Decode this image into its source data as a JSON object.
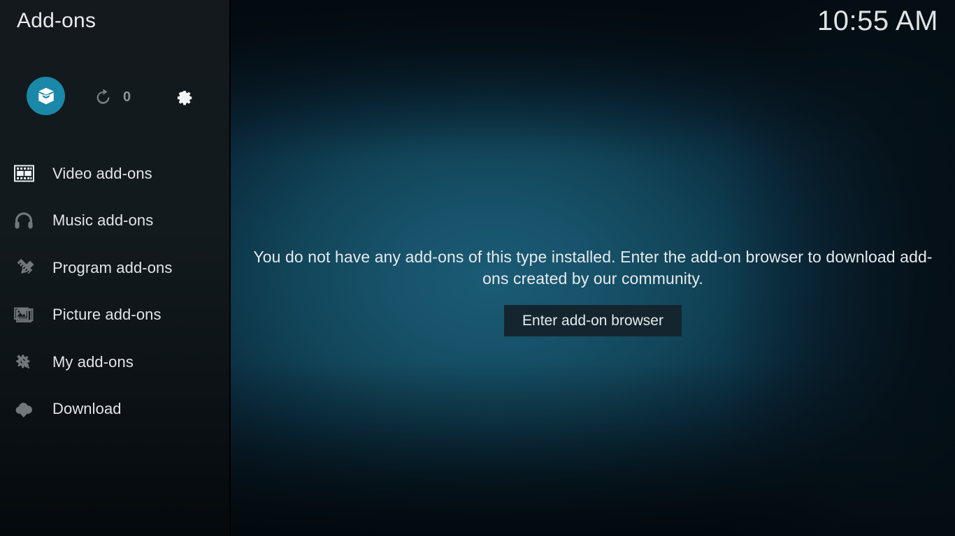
{
  "header": {
    "title": "Add-ons",
    "clock": "10:55 AM"
  },
  "icon_bar": {
    "addons_badge_icon": "open-box-icon",
    "addons_badge_color": "#1a88a8",
    "refresh_icon": "refresh-icon",
    "refresh_count": "0",
    "settings_icon": "gear-icon"
  },
  "sidebar": {
    "items": [
      {
        "label": "Video add-ons",
        "icon": "film-strip-icon",
        "selected": true
      },
      {
        "label": "Music add-ons",
        "icon": "headphones-icon",
        "selected": false
      },
      {
        "label": "Program add-ons",
        "icon": "pencil-ruler-icon",
        "selected": false
      },
      {
        "label": "Picture add-ons",
        "icon": "picture-stack-icon",
        "selected": false
      },
      {
        "label": "My add-ons",
        "icon": "gear-screwdriver-icon",
        "selected": false
      },
      {
        "label": "Download",
        "icon": "cloud-download-icon",
        "selected": false
      }
    ]
  },
  "main": {
    "empty_message": "You do not have any add-ons of this type installed. Enter the add-on browser to download add-ons created by our community.",
    "enter_browser_label": "Enter add-on browser"
  },
  "colors": {
    "accent": "#1a88a8",
    "sidebar_bg": "#13191d",
    "content_bg": "#17536b",
    "button_bg": "#14252f",
    "text_primary": "#e7eaec",
    "icon_inactive": "#72777b"
  }
}
